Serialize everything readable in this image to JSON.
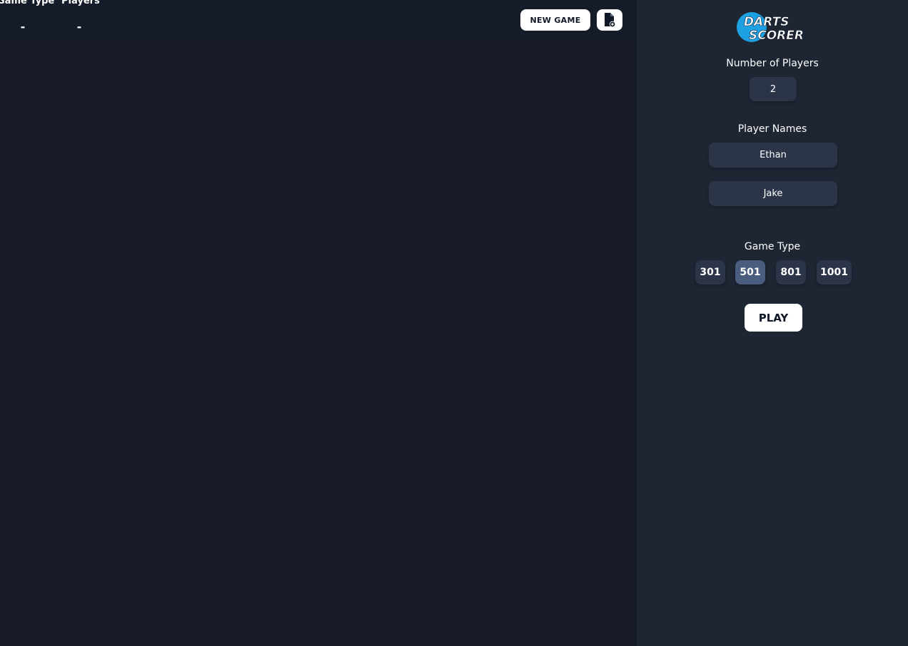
{
  "header": {
    "game_type_label": "Game Type",
    "game_type_value": "-",
    "players_label": "Players",
    "players_value": "-",
    "new_game_label": "NEW GAME",
    "file_icon": "file-add-icon"
  },
  "sidebar": {
    "logo_text_line1": "DARTS",
    "logo_text_line2": "SCORER",
    "num_players_label": "Number of Players",
    "num_players_value": "2",
    "player_names_label": "Player Names",
    "player_names": [
      "Ethan",
      "Jake"
    ],
    "game_type_label": "Game Type",
    "game_types": [
      "301",
      "501",
      "801",
      "1001"
    ],
    "selected_game_type": "501",
    "play_label": "PLAY"
  },
  "colors": {
    "main_bg": "#181c26",
    "topbar_bg": "#141c2a",
    "sidebar_bg": "#1e2533",
    "input_bg": "#2c3548",
    "selected_bg": "#4b5d7e",
    "logo_blue": "#1da1e2"
  }
}
